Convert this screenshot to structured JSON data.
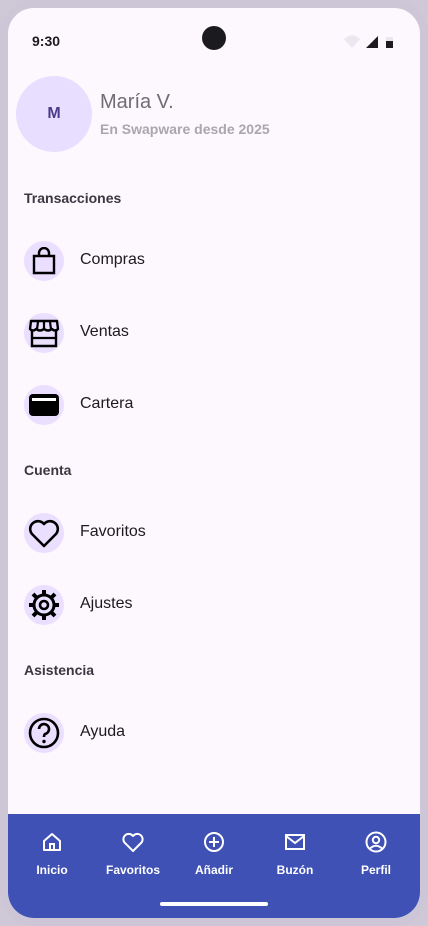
{
  "status_bar": {
    "time": "9:30"
  },
  "profile": {
    "initial": "M",
    "name": "María V.",
    "since": "En Swapware desde 2025"
  },
  "sections": {
    "transactions": {
      "title": "Transacciones",
      "items": [
        {
          "label": "Compras",
          "icon": "shopping-bag-icon"
        },
        {
          "label": "Ventas",
          "icon": "store-icon"
        },
        {
          "label": "Cartera",
          "icon": "wallet-icon"
        }
      ]
    },
    "account": {
      "title": "Cuenta",
      "items": [
        {
          "label": "Favoritos",
          "icon": "heart-icon"
        },
        {
          "label": "Ajustes",
          "icon": "gear-icon"
        }
      ]
    },
    "support": {
      "title": "Asistencia",
      "items": [
        {
          "label": "Ayuda",
          "icon": "help-icon"
        }
      ]
    }
  },
  "bottom_nav": [
    {
      "label": "Inicio",
      "icon": "home-icon"
    },
    {
      "label": "Favoritos",
      "icon": "heart-icon"
    },
    {
      "label": "Añadir",
      "icon": "add-circle-icon"
    },
    {
      "label": "Buzón",
      "icon": "mail-icon"
    },
    {
      "label": "Perfil",
      "icon": "account-circle-icon"
    }
  ],
  "colors": {
    "nav_bg": "#3f51b5",
    "icon_bg": "#eadfff",
    "page_bg": "#fdf7fe"
  }
}
